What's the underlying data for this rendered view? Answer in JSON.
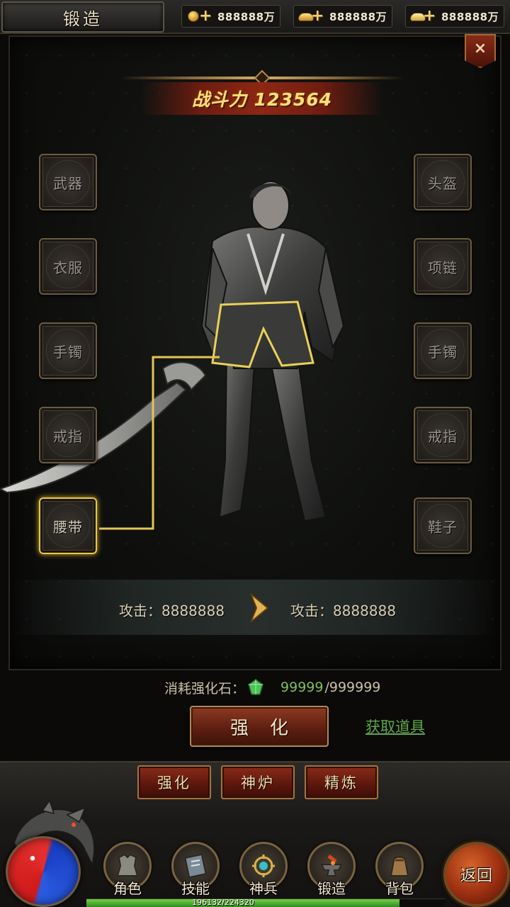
{
  "header": {
    "title": "锻造",
    "currencies": [
      {
        "icon": "coin-icon",
        "value": "888888万"
      },
      {
        "icon": "gold-ingot-icon",
        "value": "888888万"
      },
      {
        "icon": "silver-ingot-icon",
        "value": "888888万"
      }
    ],
    "close_label": "×"
  },
  "combat_power": "战斗力 123564",
  "equipment": {
    "left": [
      "武器",
      "衣服",
      "手镯",
      "戒指",
      "腰带"
    ],
    "right": [
      "头盔",
      "项链",
      "手镯",
      "戒指",
      "鞋子"
    ],
    "selected": "腰带"
  },
  "compare": {
    "current": "攻击：8888888",
    "next": "攻击：8888888"
  },
  "cost": {
    "label": "消耗强化石：",
    "current": "99999",
    "max": "/999999"
  },
  "actions": {
    "forge_label": "强化",
    "get_items_label": "获取道具"
  },
  "tabs": [
    "强化",
    "神炉",
    "精炼"
  ],
  "bottom_nav": [
    {
      "label": "角色",
      "icon": "armor-icon"
    },
    {
      "label": "技能",
      "icon": "skill-book-icon"
    },
    {
      "label": "神兵",
      "icon": "divine-weapon-icon"
    },
    {
      "label": "锻造",
      "icon": "anvil-icon"
    },
    {
      "label": "背包",
      "icon": "bag-icon"
    }
  ],
  "return_label": "返回",
  "exp": {
    "text": "196132/224320",
    "fraction": 0.874
  },
  "colors": {
    "accent_red": "#8c2814",
    "gold": "#ffe27a",
    "green": "#7fbf5a"
  }
}
